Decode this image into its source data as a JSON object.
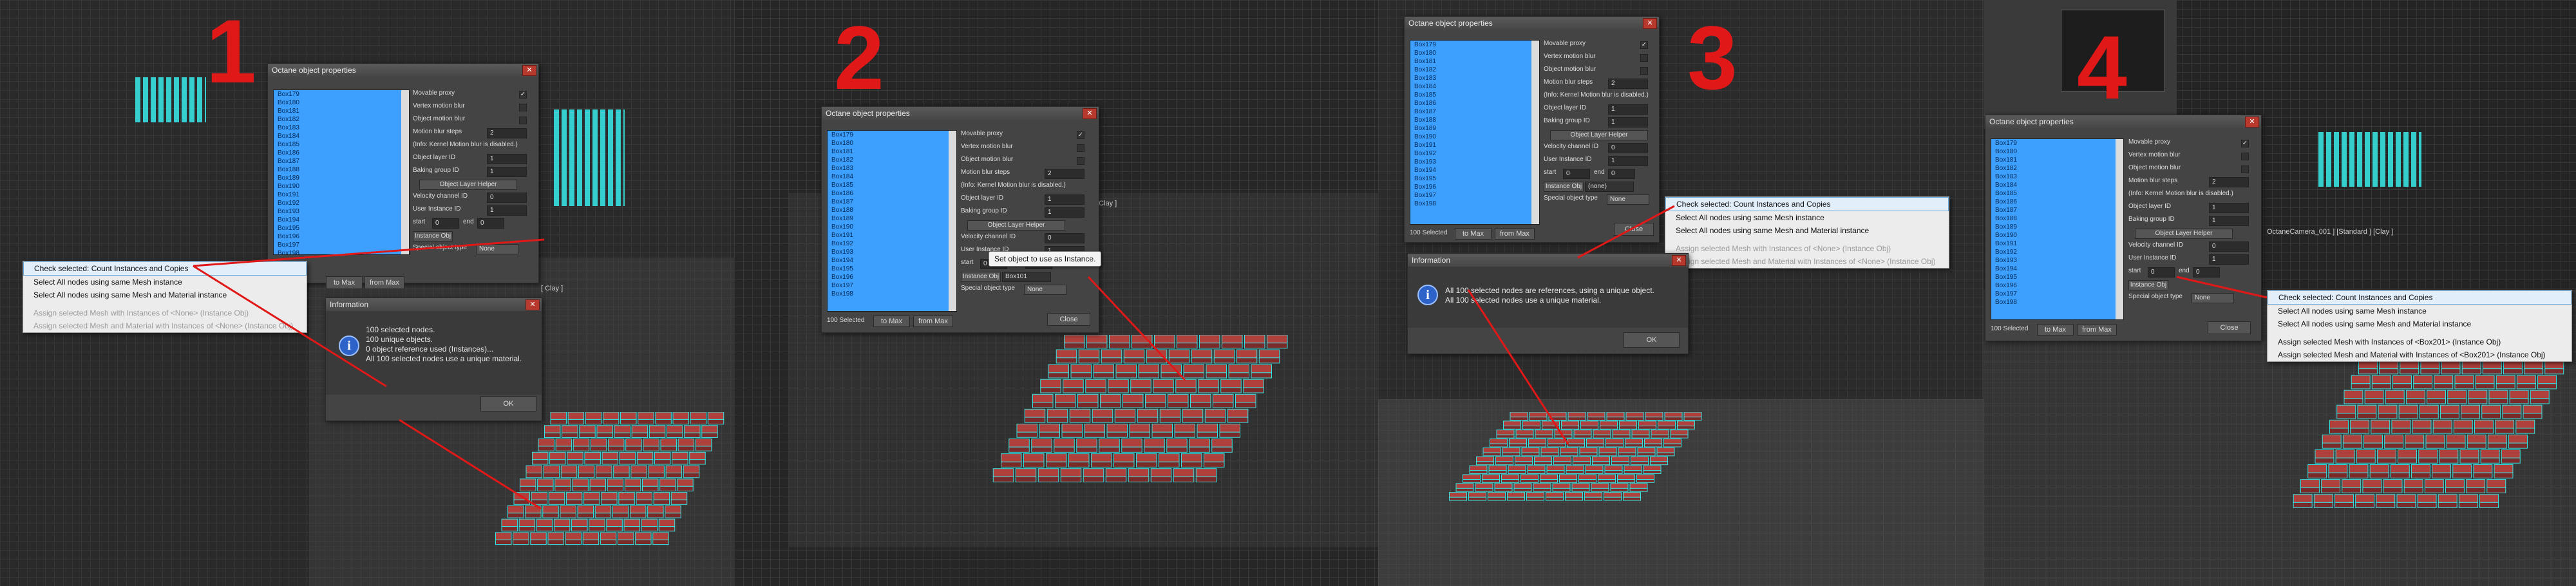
{
  "panels": [
    {
      "number": "1",
      "dialog_title": "Octane object properties",
      "list": [
        "Box179",
        "Box180",
        "Box181",
        "Box182",
        "Box183",
        "Box184",
        "Box185",
        "Box186",
        "Box187",
        "Box188",
        "Box189",
        "Box190",
        "Box191",
        "Box192",
        "Box193",
        "Box194",
        "Box195",
        "Box196",
        "Box197",
        "Box198"
      ],
      "context_menu": [
        {
          "label": "Check selected: Count Instances and Copies",
          "state": "highlight"
        },
        {
          "label": "Select All nodes using same Mesh instance",
          "state": "normal"
        },
        {
          "label": "Select All nodes using same Mesh and Material instance",
          "state": "normal"
        },
        {
          "label": "",
          "state": "sep"
        },
        {
          "label": "Assign selected Mesh with Instances of <None> (Instance Obj)",
          "state": "disabled"
        },
        {
          "label": "Assign selected Mesh and Material with Instances of <None> (Instance Obj)",
          "state": "disabled"
        }
      ],
      "info_title": "Information",
      "info_message": "100 selected nodes.\n100 unique objects.\n0 object reference used (Instances)...\nAll 100 selected nodes use a unique material.",
      "ok": "OK",
      "to_max": "to Max",
      "from_max": "from Max",
      "vp_label": "[ Clay ]"
    },
    {
      "number": "2",
      "dialog_title": "Octane object properties",
      "list": [
        "Box179",
        "Box180",
        "Box181",
        "Box182",
        "Box183",
        "Box184",
        "Box185",
        "Box186",
        "Box187",
        "Box188",
        "Box189",
        "Box190",
        "Box191",
        "Box192",
        "Box193",
        "Box194",
        "Box195",
        "Box196",
        "Box197",
        "Box198"
      ],
      "tooltip": "Set object to use as Instance.",
      "instance_value": "Box101",
      "selected_count": "100 Selected",
      "close": "Close",
      "vp_label": "[ Clay ]"
    },
    {
      "number": "3",
      "dialog_title": "Octane object properties",
      "list": [
        "Box179",
        "Box180",
        "Box181",
        "Box182",
        "Box183",
        "Box184",
        "Box185",
        "Box186",
        "Box187",
        "Box188",
        "Box189",
        "Box190",
        "Box191",
        "Box192",
        "Box193",
        "Box194",
        "Box195",
        "Box196",
        "Box197",
        "Box198"
      ],
      "context_menu": [
        {
          "label": "Check selected: Count Instances and Copies",
          "state": "highlight"
        },
        {
          "label": "Select All nodes using same Mesh instance",
          "state": "normal"
        },
        {
          "label": "Select All nodes using same Mesh and Material instance",
          "state": "normal"
        },
        {
          "label": "",
          "state": "sep"
        },
        {
          "label": "Assign selected Mesh with Instances of <None> (Instance Obj)",
          "state": "disabled"
        },
        {
          "label": "Assign selected Mesh and Material with Instances of <None> (Instance Obj)",
          "state": "disabled"
        }
      ],
      "info_title": "Information",
      "info_message": "All 100 selected nodes are references, using a unique object.\nAll 100 selected nodes use a unique material.",
      "ok": "OK",
      "selected_count": "100 Selected",
      "instance_value": "(none)",
      "close": "Close"
    },
    {
      "number": "4",
      "dialog_title": "Octane object properties",
      "list": [
        "Box179",
        "Box180",
        "Box181",
        "Box182",
        "Box183",
        "Box184",
        "Box185",
        "Box186",
        "Box187",
        "Box188",
        "Box189",
        "Box190",
        "Box191",
        "Box192",
        "Box193",
        "Box194",
        "Box195",
        "Box196",
        "Box197",
        "Box198"
      ],
      "context_menu": [
        {
          "label": "Check selected: Count Instances and Copies",
          "state": "highlight"
        },
        {
          "label": "Select All nodes using same Mesh instance",
          "state": "normal"
        },
        {
          "label": "Select All nodes using same Mesh and Material instance",
          "state": "normal"
        },
        {
          "label": "",
          "state": "sep"
        },
        {
          "label": "Assign selected Mesh with Instances of <Box201> (Instance Obj)",
          "state": "normal"
        },
        {
          "label": "Assign selected Mesh and Material with Instances of <Box201> (Instance Obj)",
          "state": "normal"
        }
      ],
      "selected_count": "100 Selected",
      "close": "Close",
      "vp_label": "OctaneCamera_001 ] [Standard ] [Clay ]"
    }
  ],
  "props": {
    "movable_proxy": "Movable proxy",
    "vertex_motion_blur": "Vertex motion blur",
    "object_motion_blur": "Object motion blur",
    "motion_blur_steps": "Motion blur steps",
    "info_kernel": "(Info: Kernel Motion blur is disabled.)",
    "object_layer_id": "Object layer ID",
    "baking_group_id": "Baking group ID",
    "object_layer_helper": "Object Layer Helper",
    "velocity_channel_id": "Velocity channel ID",
    "user_instance_id": "User Instance ID",
    "start": "start",
    "end": "end",
    "instance_obj": "Instance Obj",
    "special_object_type": "Special object type",
    "special_value": "None",
    "steps_value": "2",
    "one": "1",
    "zero": "0"
  },
  "colors": {
    "accent_red": "#e01818",
    "selection_blue": "#3da0ff",
    "brick": "#b0403c",
    "cyan": "#38e0e0"
  }
}
